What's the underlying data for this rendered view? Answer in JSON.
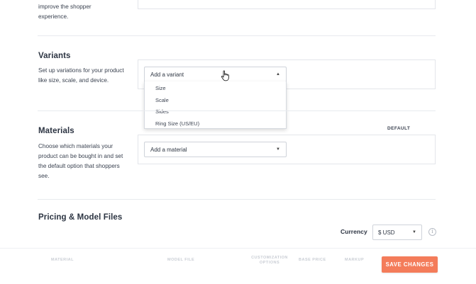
{
  "top": {
    "description_tail": "improve the shopper experience."
  },
  "variants": {
    "title": "Variants",
    "description": "Set up variations for your product like size, scale, and device.",
    "select_value": "Add a variant",
    "options": [
      "Size",
      "Scale",
      "Sides",
      "Ring Size (US/EU)"
    ]
  },
  "materials": {
    "title": "Materials",
    "description": "Choose which materials your product can be bought in and set the default option that shoppers see.",
    "default_label": "DEFAULT",
    "select_value": "Add a material"
  },
  "pricing": {
    "title": "Pricing & Model Files",
    "currency_label": "Currency",
    "currency_value": "$ USD"
  },
  "footer": {
    "columns": [
      "MATERIAL",
      "MODEL FILE",
      "CUSTOMIZATION OPTIONS",
      "BASE PRICE",
      "MARKUP"
    ],
    "save_label": "SAVE CHANGES"
  },
  "colors": {
    "accent": "#f47c5a",
    "text": "#2c3442",
    "border": "#e3e5ea"
  },
  "icons": {
    "caret_up": "caret-up-icon",
    "caret_down": "caret-down-icon",
    "cursor": "hand-pointer-icon",
    "info": "info-icon"
  }
}
